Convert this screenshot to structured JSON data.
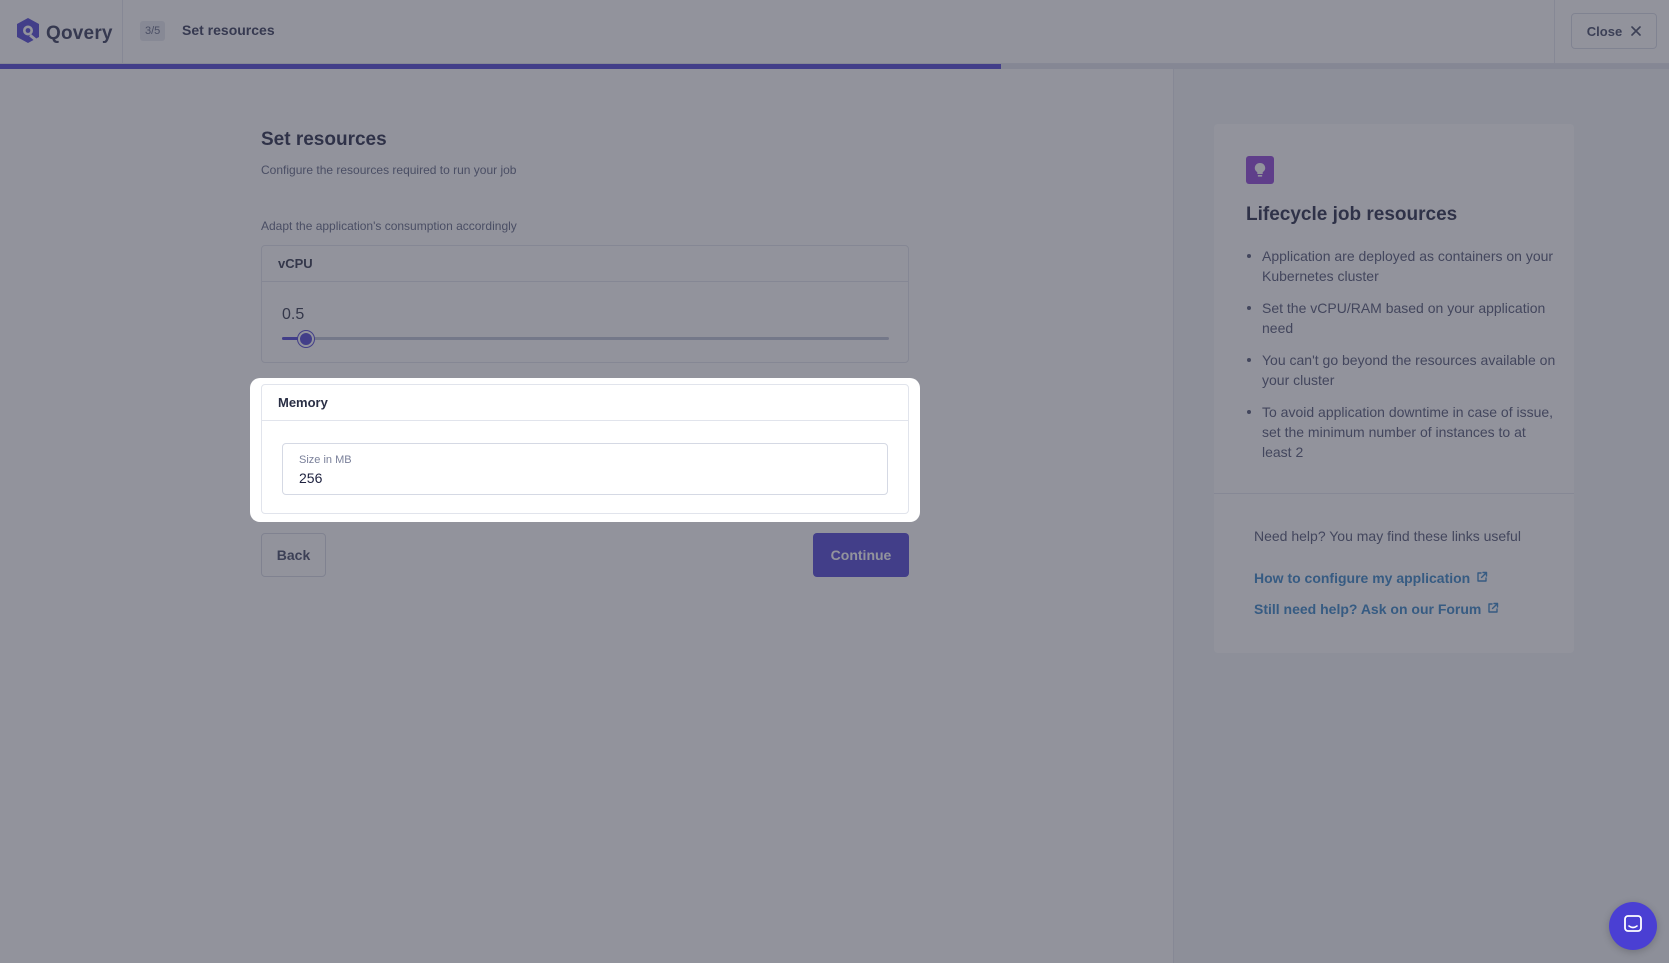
{
  "header": {
    "brand": "Qovery",
    "step": "3/5",
    "title": "Set resources",
    "close_label": "Close",
    "progress_percent": 60
  },
  "main": {
    "title": "Set resources",
    "subtitle": "Configure the resources required to run your job",
    "section_desc": "Adapt the application's consumption accordingly",
    "vcpu": {
      "label": "vCPU",
      "value": "0.5",
      "slider_fraction": 0.04
    },
    "memory": {
      "label": "Memory",
      "field_label": "Size in MB",
      "field_value": "256"
    },
    "back_label": "Back",
    "continue_label": "Continue"
  },
  "help": {
    "title": "Lifecycle job resources",
    "bullets": [
      "Application are deployed as containers on your Kubernetes cluster",
      "Set the vCPU/RAM based on your application need",
      "You can't go beyond the resources available on your cluster",
      "To avoid application downtime in case of issue, set the minimum number of instances to at least 2"
    ],
    "need_help": "Need help? You may find these links useful",
    "links": [
      "How to configure my application",
      "Still need help? Ask on our Forum"
    ]
  },
  "colors": {
    "accent": "#4a3fd3",
    "help_icon_bg": "#8b3fd6",
    "link": "#2f7fc5"
  },
  "icons": {
    "logo": "qovery-logo-icon",
    "close": "close-icon",
    "bulb": "lightbulb-icon",
    "external": "external-link-icon",
    "chat": "chat-icon"
  }
}
